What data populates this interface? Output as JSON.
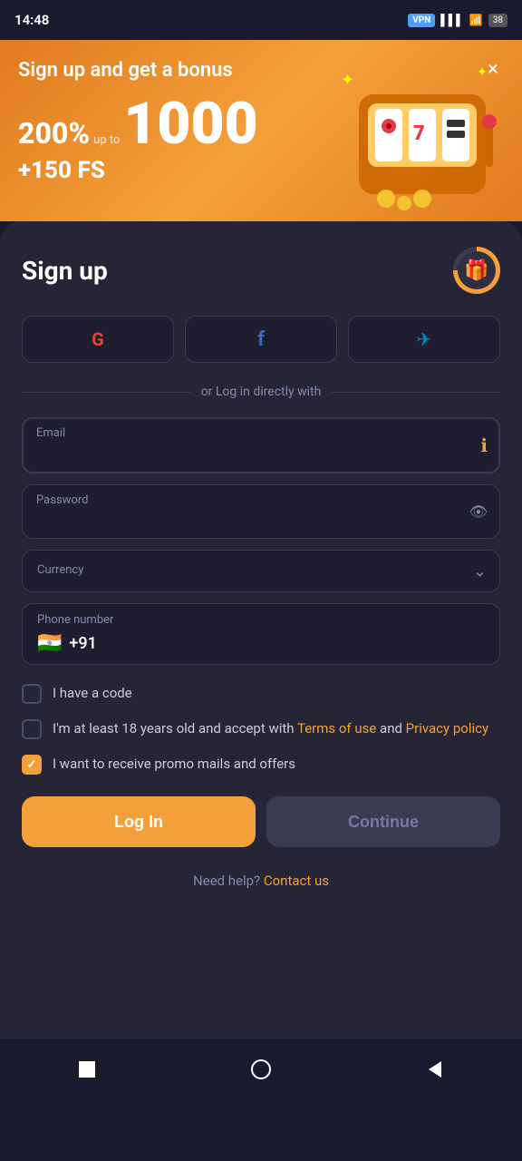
{
  "statusBar": {
    "time": "14:48",
    "vpn": "VPN",
    "battery": "38"
  },
  "banner": {
    "title": "Sign up and get a bonus",
    "bonusPercent": "200%",
    "bonusUpTo": "up to",
    "bonusAmount": "1000",
    "bonusFS": "+150 FS",
    "closeLabel": "×"
  },
  "form": {
    "title": "Sign up",
    "dividerText": "or Log in directly with",
    "emailLabel": "Email",
    "emailPlaceholder": "",
    "passwordLabel": "Password",
    "currencyLabel": "Currency",
    "phoneLabel": "Phone number",
    "phoneValue": "+91",
    "flagEmoji": "🇮🇳",
    "checkboxes": [
      {
        "label": "I have a code",
        "checked": false
      },
      {
        "label_pre": "I'm at least 18 years old and accept with ",
        "link1": "Terms of use",
        "label_mid": " and ",
        "link2": "Privacy policy",
        "checked": false
      },
      {
        "label": "I want to receive promo mails and offers",
        "checked": true
      }
    ],
    "loginBtn": "Log In",
    "continueBtn": "Continue"
  },
  "footer": {
    "needHelp": "Need help?",
    "contactUs": "Contact us"
  },
  "social": {
    "google": "G",
    "facebook": "f",
    "telegram": "➤"
  }
}
